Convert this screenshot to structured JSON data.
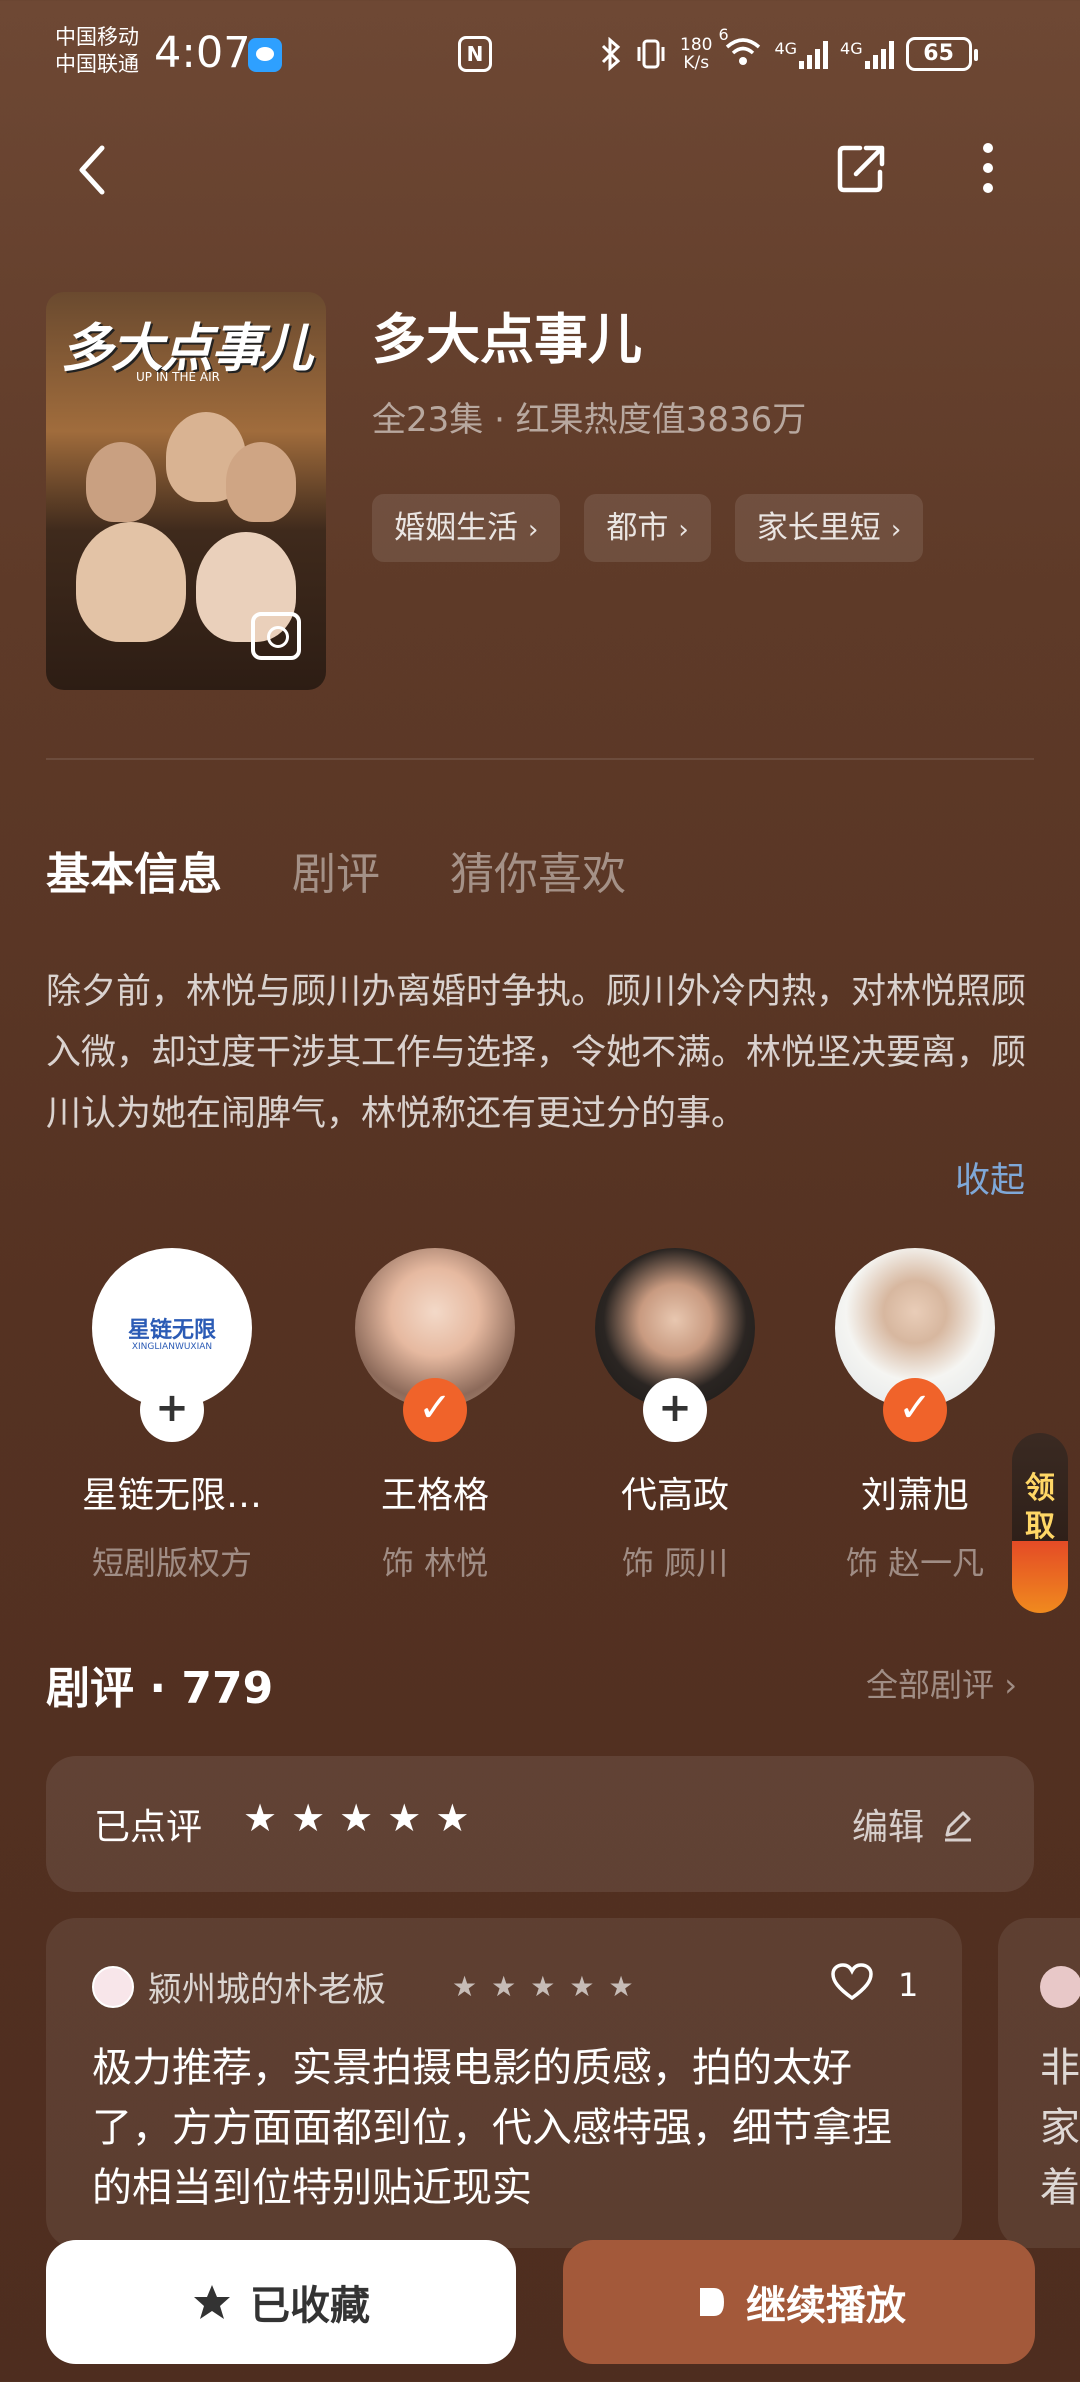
{
  "status_bar": {
    "carrier1": "中国移动",
    "carrier2": "中国联通",
    "time": "4:07",
    "speed_top": "180",
    "speed_bottom": "K/s",
    "wifi_label": "6",
    "net1": "4G",
    "net2": "4G",
    "battery": "65"
  },
  "nav": {
    "back_icon": "back-arrow-icon",
    "share_icon": "share-icon",
    "more_icon": "more-vertical-icon"
  },
  "show": {
    "poster_title": "多大点事儿",
    "poster_sub": "UP IN THE AIR",
    "title": "多大点事儿",
    "meta": "全23集 · 红果热度值3836万",
    "tags": [
      {
        "label": "婚姻生活"
      },
      {
        "label": "都市"
      },
      {
        "label": "家长里短"
      }
    ]
  },
  "tabs": [
    {
      "label": "基本信息",
      "active": true
    },
    {
      "label": "剧评",
      "active": false
    },
    {
      "label": "猜你喜欢",
      "active": false
    }
  ],
  "synopsis": "除夕前，林悦与顾川办离婚时争执。顾川外冷内热，对林悦照顾入微，却过度干涉其工作与选择，令她不满。林悦坚决要离，顾川认为她在闹脾气，林悦称还有更过分的事。",
  "collapse_label": "收起",
  "cast": [
    {
      "name": "星链无限…",
      "role": "短剧版权方",
      "badge": "+",
      "logo_text": "星链无限",
      "logo_sub": "XINGLIANWUXIAN"
    },
    {
      "name": "王格格",
      "role": "饰 林悦",
      "badge": "✓"
    },
    {
      "name": "代高政",
      "role": "饰 顾川",
      "badge": "+"
    },
    {
      "name": "刘萧旭",
      "role": "饰 赵一凡",
      "badge": "✓"
    }
  ],
  "claim": {
    "label1": "领",
    "label2": "取"
  },
  "reviews": {
    "heading": "剧评 · 779",
    "all_label": "全部剧评",
    "my_review": {
      "label": "已点评",
      "stars": 5,
      "edit_label": "编辑"
    },
    "items": [
      {
        "user": "颍州城的朴老板",
        "stars": 5,
        "likes": "1",
        "text": "极力推荐，实景拍摄电影的质感，拍的太好了，方方面面都到位，代入感特强，细节拿捏的相当到位特别贴近现实"
      },
      {
        "text": "非家着"
      }
    ]
  },
  "bottom": {
    "fav_label": "已收藏",
    "play_label": "继续播放"
  },
  "colors": {
    "accent_orange": "#f0632a",
    "play_button": "#a3593a",
    "link_blue": "#7fa8d8"
  }
}
